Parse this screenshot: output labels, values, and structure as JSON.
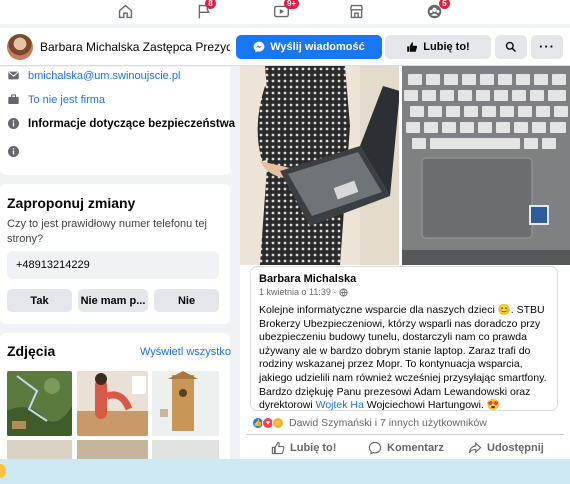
{
  "nav": {
    "items": [
      {
        "icon": "home-icon",
        "badge": ""
      },
      {
        "icon": "flag-icon",
        "badge": "8"
      },
      {
        "icon": "video-icon",
        "badge": "9+"
      },
      {
        "icon": "marketplace-icon",
        "badge": ""
      },
      {
        "icon": "groups-icon",
        "badge": "5"
      }
    ]
  },
  "profile_bar": {
    "name": "Barbara Michalska Zastępca Prezydenta Miasta Świnoujście",
    "message_button": "Wyślij wiadomość",
    "like_button": "Lubię to!"
  },
  "intro": {
    "email": "bmichalska@um.swinoujscie.pl",
    "business": "To nie jest firma",
    "safety": "Informacje dotyczące bezpieczeństwa"
  },
  "suggest": {
    "title": "Zaproponuj zmiany",
    "question": "Czy to jest prawidłowy numer telefonu tej strony?",
    "phone": "+48913214229",
    "buttons": [
      "Tak",
      "Nie mam p...",
      "Nie"
    ]
  },
  "photos": {
    "title": "Zdjęcia",
    "see_all": "Wyświetl wszystko"
  },
  "post": {
    "author": "Barbara Michalska",
    "date": "1 kwietnia o 11:39 ·",
    "text_main": "Kolejne informatyczne wsparcie dla naszych dzieci 😊. STBU Brokerzy Ubezpieczeniowi, którzy wsparli nas doradczo przy ubezpieczeniu budowy tunelu, dostarczyli nam co prawda używany ale w bardzo dobrym stanie laptop. Zaraz trafi do rodziny wskazanej przez Mopr. To kontynuacja wsparcia, jakiego udzielili nam również wcześniej przysyłając smartfony. Bardzo dziękuję Panu prezesowi Adam Lewandowski oraz dyrektorowi ",
    "text_link": "Wojtek Ha",
    "text_end": " Wojciechowi Hartungowi. 😍",
    "reactions": "Dawid Szymański i 7 innych użytkowników",
    "actions": {
      "like": "Lubię to!",
      "comment": "Komentarz",
      "share": "Udostępnij"
    }
  },
  "colors": {
    "primary": "#1877f2",
    "background": "#f0f2f5",
    "button_gray": "#e4e6eb",
    "badge": "#e41e3f"
  }
}
